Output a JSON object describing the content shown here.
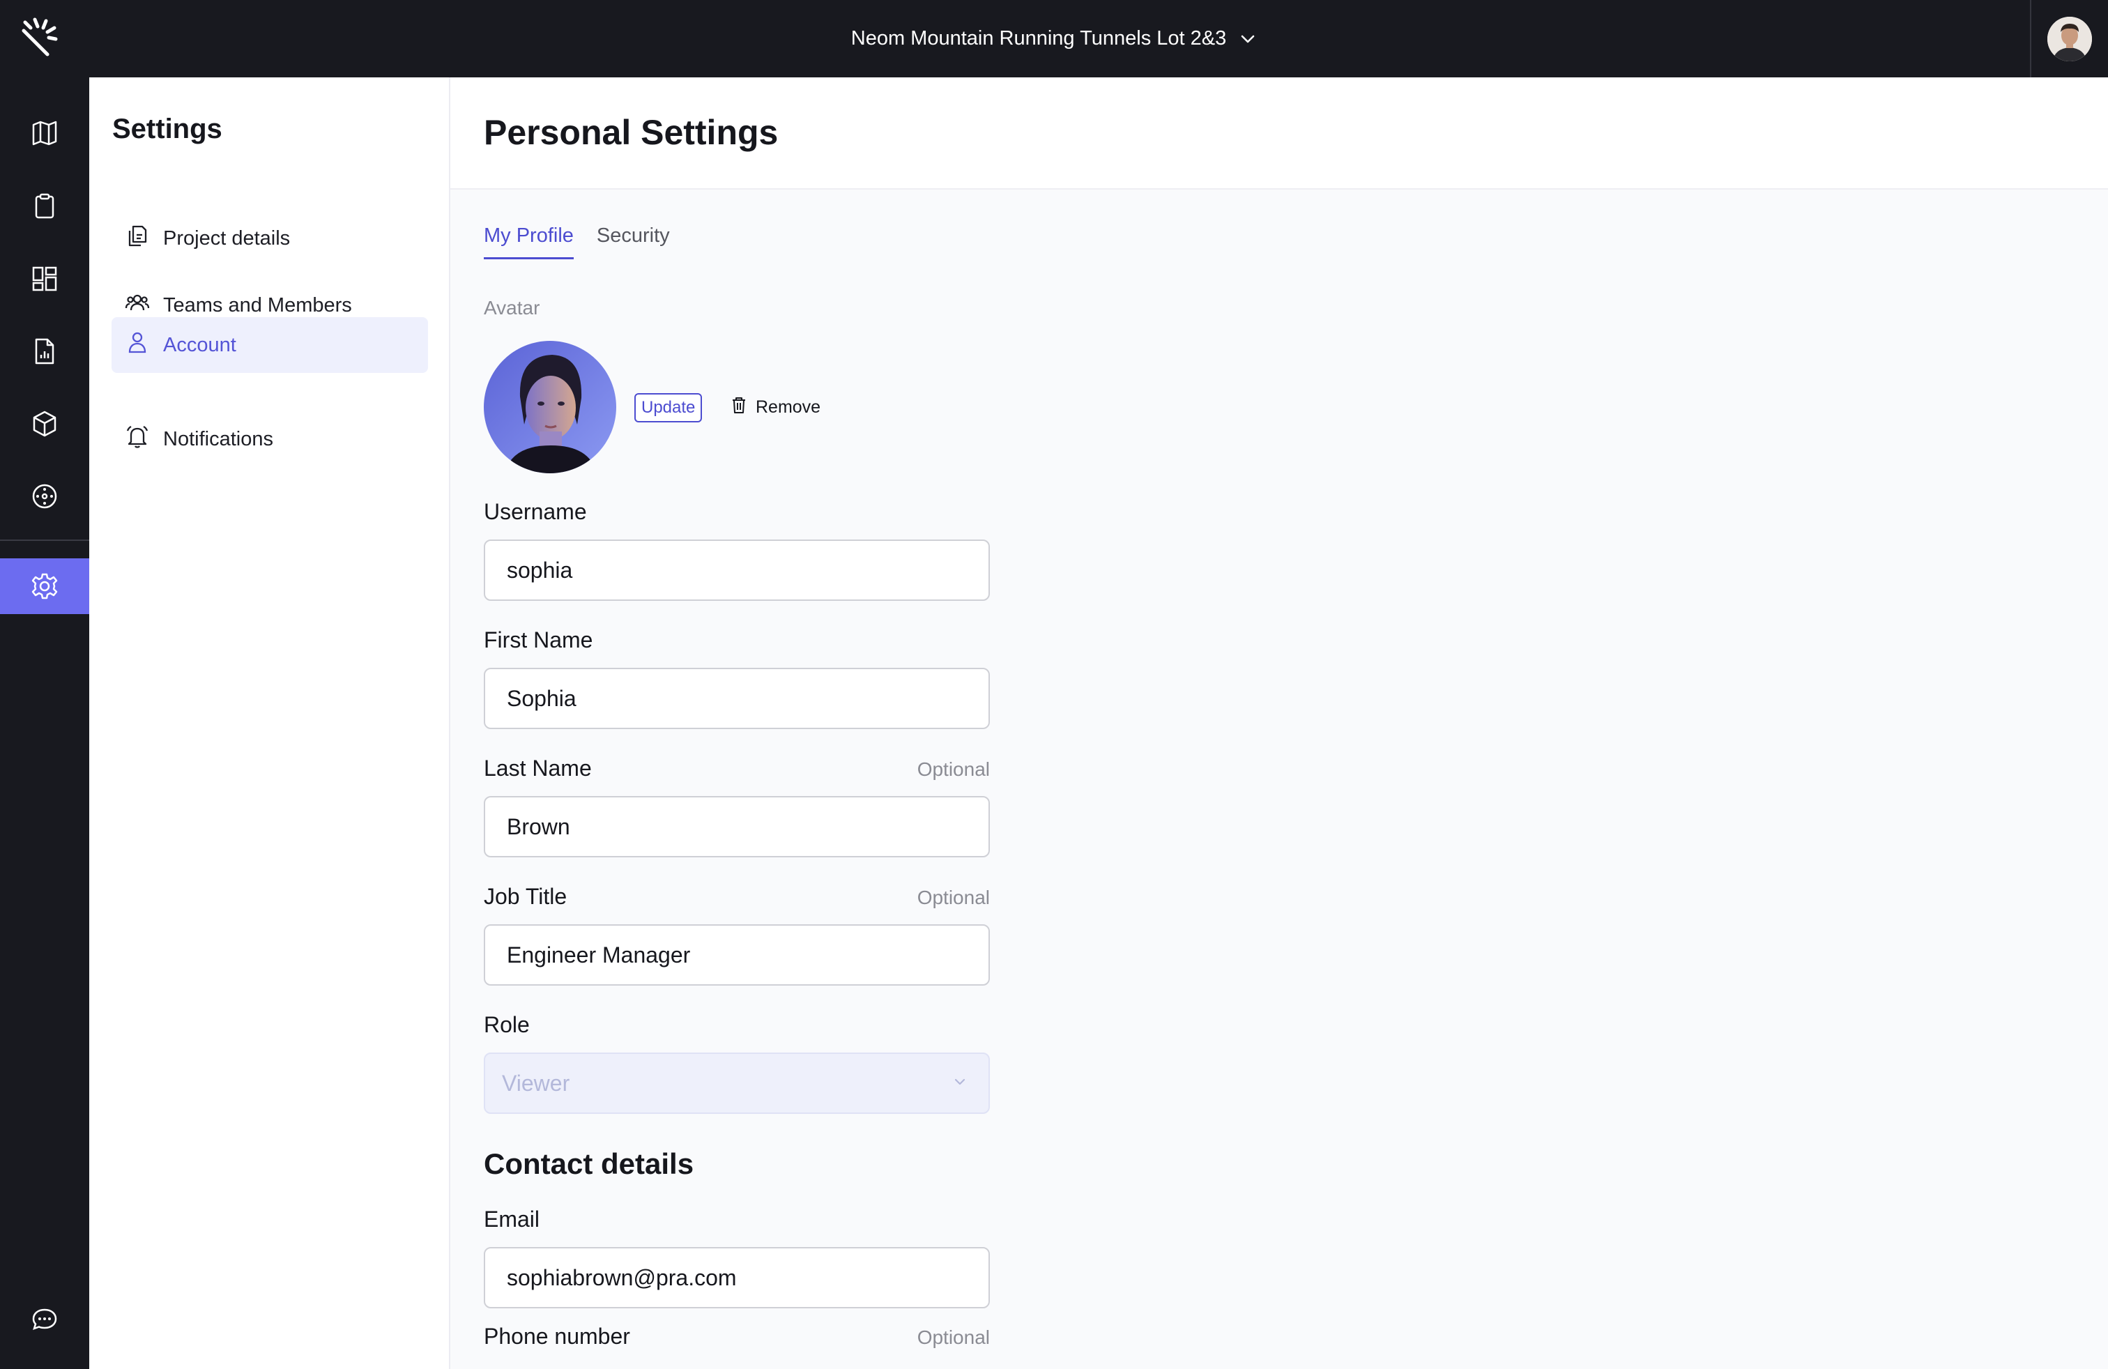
{
  "topbar": {
    "project_name": "Neom Mountain Running Tunnels Lot 2&3",
    "logo_icon": "sparkle-logo-icon",
    "user_avatar_icon": "user-avatar-photo"
  },
  "rail": {
    "items": [
      {
        "icon": "map-icon"
      },
      {
        "icon": "clipboard-icon"
      },
      {
        "icon": "dashboard-icon"
      },
      {
        "icon": "report-file-icon"
      },
      {
        "icon": "cube-icon"
      },
      {
        "icon": "target-icon"
      },
      {
        "icon": "gear-icon",
        "active": true
      },
      {
        "icon": "chat-icon"
      }
    ],
    "active_color": "#6c6cf0"
  },
  "settings_nav": {
    "title": "Settings",
    "items": [
      {
        "label": "Project details",
        "icon": "documents-icon"
      },
      {
        "label": "Teams and Members",
        "icon": "users-icon"
      },
      {
        "label": "Account",
        "icon": "person-icon",
        "active": true
      },
      {
        "label": "Notifications",
        "icon": "bell-icon"
      }
    ]
  },
  "page": {
    "title": "Personal Settings",
    "tabs": [
      {
        "label": "My Profile",
        "active": true
      },
      {
        "label": "Security"
      }
    ],
    "accent": "#4c4cd0"
  },
  "avatar": {
    "label": "Avatar",
    "update_label": "Update",
    "remove_label": "Remove"
  },
  "form": {
    "username": {
      "label": "Username",
      "value": "sophia"
    },
    "first_name": {
      "label": "First Name",
      "value": "Sophia"
    },
    "last_name": {
      "label": "Last Name",
      "value": "Brown",
      "optional": "Optional"
    },
    "job_title": {
      "label": "Job Title",
      "value": "Engineer Manager",
      "optional": "Optional"
    },
    "role": {
      "label": "Role",
      "value": "Viewer"
    }
  },
  "contact": {
    "title": "Contact details",
    "email": {
      "label": "Email",
      "value": "sophiabrown@pra.com"
    },
    "phone": {
      "label": "Phone number",
      "optional": "Optional"
    }
  }
}
